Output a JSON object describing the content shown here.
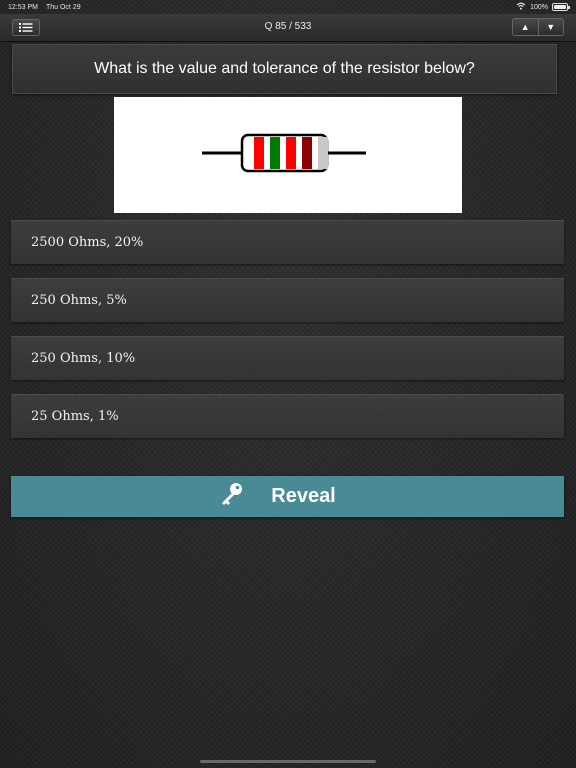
{
  "status_bar": {
    "time": "12:53 PM",
    "date": "Thu Oct 29",
    "battery": "100%",
    "wifi_icon": "wifi-icon",
    "battery_icon": "battery-icon"
  },
  "toolbar": {
    "menu_icon": "list-icon",
    "counter": "Q 85 / 533",
    "up_label": "▲",
    "down_label": "▼"
  },
  "question": {
    "text": "What is the value and tolerance of the resistor below?",
    "image": {
      "type": "resistor-diagram",
      "band_colors": [
        "#ff0000",
        "#007a00",
        "#ff0000",
        "#8b0000",
        "#c8c8c8"
      ]
    }
  },
  "options": [
    {
      "label": "2500 Ohms, 20%"
    },
    {
      "label": "250 Ohms, 5%"
    },
    {
      "label": "250 Ohms, 10%"
    },
    {
      "label": "25 Ohms, 1%"
    }
  ],
  "reveal": {
    "label": "Reveal",
    "icon": "key-icon",
    "color": "#4a8a94"
  }
}
